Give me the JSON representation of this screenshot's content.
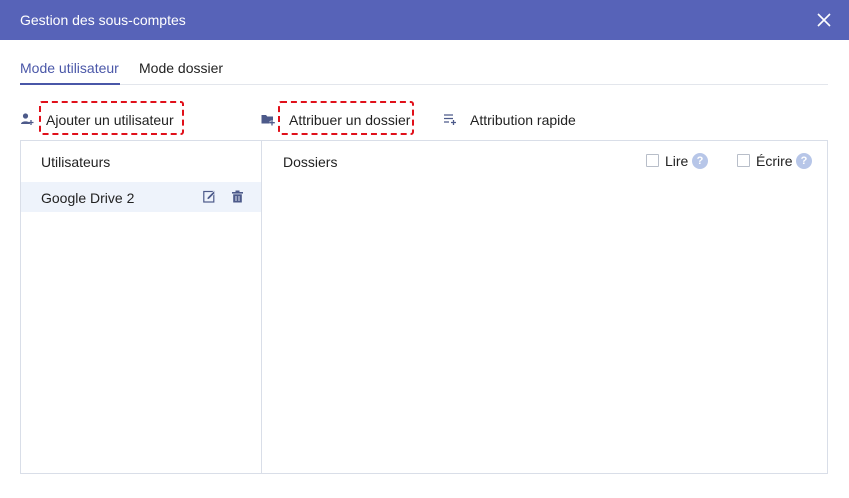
{
  "window": {
    "title": "Gestion des sous-comptes",
    "close_icon": "close-icon"
  },
  "tabs": [
    {
      "label": "Mode utilisateur",
      "active": true
    },
    {
      "label": "Mode dossier",
      "active": false
    }
  ],
  "toolbar": {
    "add_user": {
      "label": "Ajouter un utilisateur",
      "icon": "add-user-icon"
    },
    "assign_folder": {
      "label": "Attribuer un dossier",
      "icon": "add-folder-icon"
    },
    "quick_assign": {
      "label": "Attribution rapide",
      "icon": "quick-list-icon"
    }
  },
  "users_panel": {
    "header": "Utilisateurs",
    "items": [
      {
        "name": "Google Drive 2",
        "selected": true
      }
    ]
  },
  "folders_panel": {
    "header": "Dossiers",
    "read_label": "Lire",
    "write_label": "Écrire",
    "help_glyph": "?"
  },
  "colors": {
    "titlebar": "#5763b8",
    "accent": "#4a57a8",
    "highlight_dash": "#e0101a",
    "selected_row": "#eef3fb",
    "border": "#d9dee8"
  }
}
